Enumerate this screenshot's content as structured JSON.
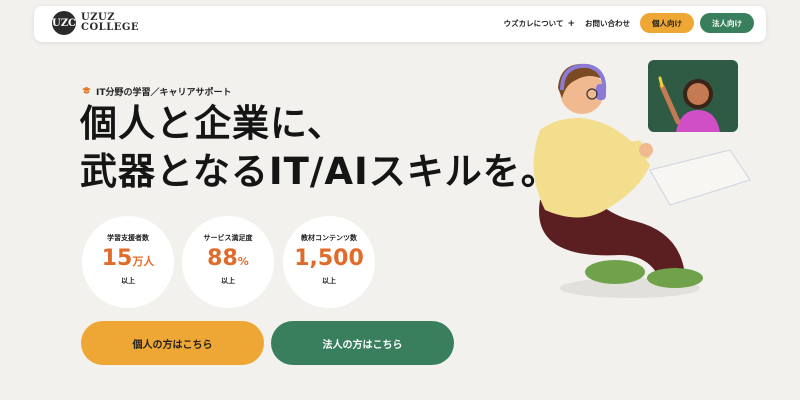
{
  "header": {
    "logo_mark": "UZC",
    "logo_line1": "UZUZ",
    "logo_line2": "COLLEGE",
    "nav_about": "ウズカレについて",
    "nav_about_icon": "+",
    "nav_contact": "お問い合わせ",
    "btn_personal": "個人向け",
    "btn_corporate": "法人向け"
  },
  "hero": {
    "tagline_icon": "mortarboard-icon",
    "tagline": "IT分野の学習／キャリアサポート",
    "headline_line1": "個人と企業に、",
    "headline_line2": "武器となるIT/AIスキルを。"
  },
  "stats": [
    {
      "label": "学習支援者数",
      "value": "15",
      "unit": "万人",
      "sub": "以上"
    },
    {
      "label": "サービス満足度",
      "value": "88",
      "unit": "%",
      "sub": "以上"
    },
    {
      "label": "教材コンテンツ数",
      "value": "1,500",
      "unit": "",
      "sub": "以上"
    }
  ],
  "cta": {
    "personal": "個人の方はこちら",
    "corporate": "法人の方はこちら"
  },
  "colors": {
    "accent_orange": "#eea734",
    "accent_green": "#3a7f5d",
    "stat_orange": "#e06b2a",
    "background": "#f2f1ee"
  }
}
